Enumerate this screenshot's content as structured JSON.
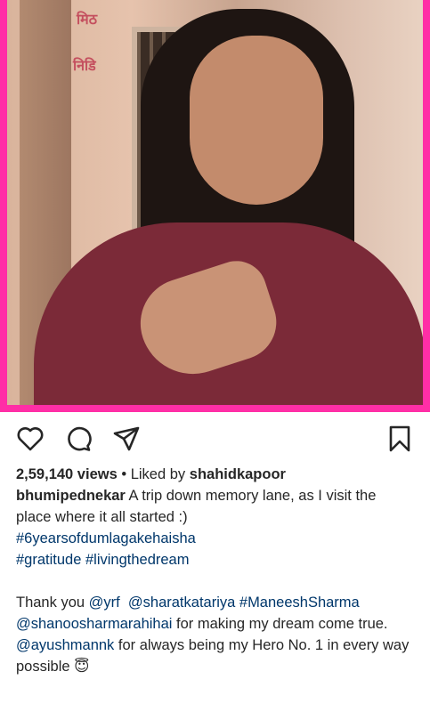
{
  "post": {
    "wall_text_1": "मिठ",
    "wall_text_2": "निडि",
    "views": "2,59,140 views",
    "bullet": " • ",
    "liked_by_prefix": "Liked by ",
    "liked_by_user": "shahidkapoor",
    "author": "bhumipednekar",
    "caption_line1": " A trip down memory lane, as I visit the place where it all started :)",
    "hashtag1": "#6yearsofdumlagakehaisha",
    "hashtag2": "#gratitude",
    "hashtag3": "#livingthedream",
    "thank_you": "Thank you ",
    "mention_yrf": "@yrf",
    "mention_sharat": "@sharatkatariya",
    "hashtag_maneesh": "#ManeeshSharma",
    "mention_shanoo": "@shanoosharmarahihai",
    "dream_text": " for making my dream come true.",
    "mention_ayush": "@ayushmannk",
    "hero_text": " for always being my Hero No. 1 in every way possible ",
    "emoji": "😇"
  },
  "colors": {
    "frame": "#ff2ea6",
    "link": "#00376b"
  },
  "icons": [
    "heart-icon",
    "comment-icon",
    "share-icon",
    "bookmark-icon"
  ]
}
